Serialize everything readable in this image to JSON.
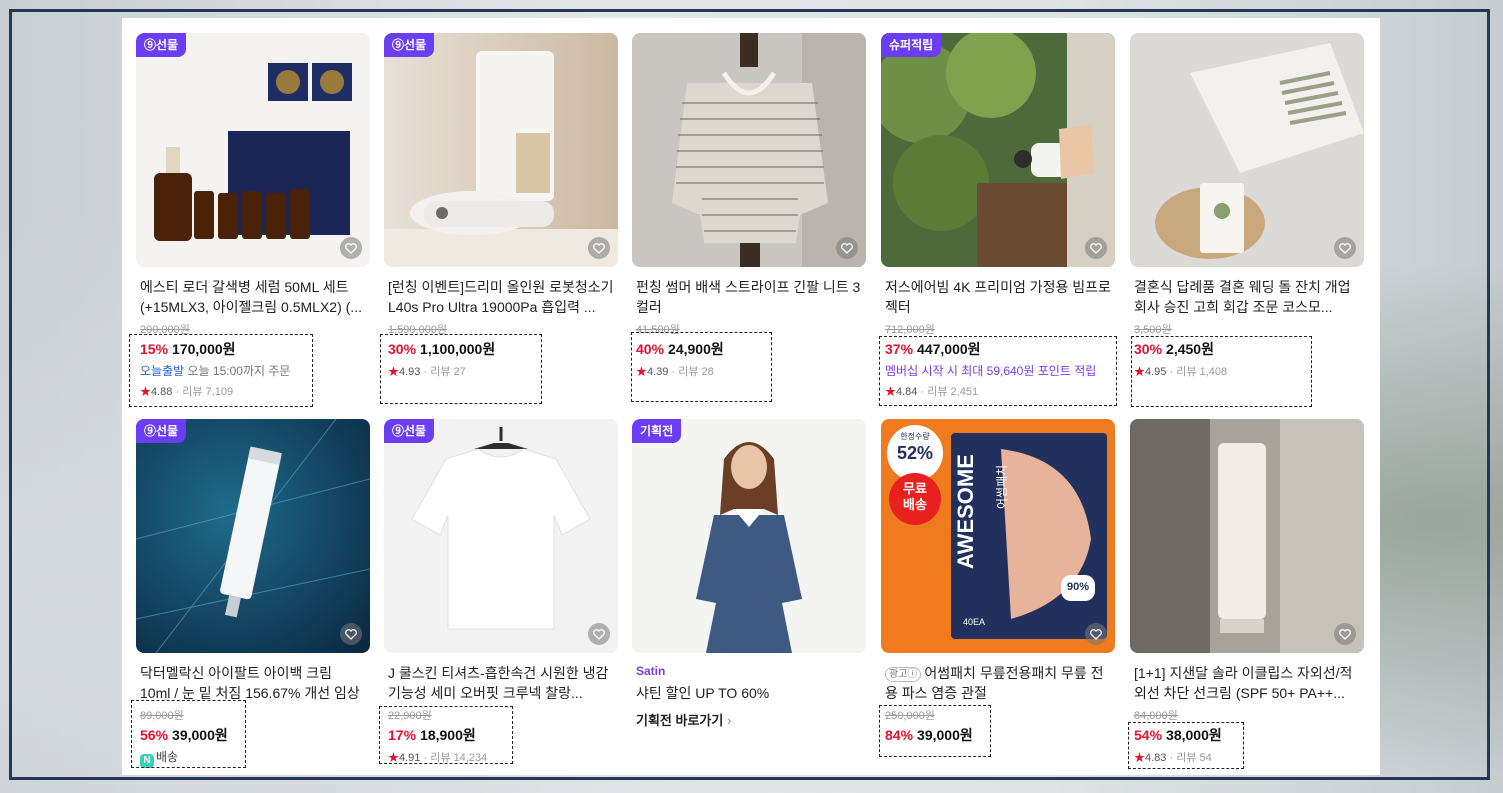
{
  "colors": {
    "discount": "#e4112e",
    "badge_purple": "#6b3df5",
    "frame": "#253a52"
  },
  "products": [
    {
      "badge": "⑨선물",
      "title": "에스티 로더 갈색병 세럼 50ML 세트 (+15MLX3, 아이젤크림 0.5MLX2) (...",
      "original_price": "200,000원",
      "discount": "15%",
      "price": "170,000원",
      "promo_a": "오늘출발",
      "promo_b": "오늘 15:00까지 주문",
      "rating": "4.88",
      "review_label": "리뷰",
      "reviews": "7,109"
    },
    {
      "badge": "⑨선물",
      "title": "[런칭 이벤트]드리미 올인원 로봇청소기 L40s Pro Ultra 19000Pa 흡입력 ...",
      "original_price": "1,590,000원",
      "discount": "30%",
      "price": "1,100,000원",
      "rating": "4.93",
      "review_label": "리뷰",
      "reviews": "27"
    },
    {
      "title": "펀칭 썸머 배색 스트라이프 긴팔 니트 3컬러",
      "original_price": "41,500원",
      "discount": "40%",
      "price": "24,900원",
      "rating": "4.39",
      "review_label": "리뷰",
      "reviews": "28"
    },
    {
      "badge": "슈퍼적립",
      "title": "저스에어빔 4K 프리미엄 가정용 빔프로젝터",
      "original_price": "712,000원",
      "discount": "37%",
      "price": "447,000원",
      "promo": "멤버십 시작 시 최대 59,640원 포인트 적립",
      "rating": "4.84",
      "review_label": "리뷰",
      "reviews": "2,451"
    },
    {
      "title": "결혼식 답례품 결혼 웨딩 돌 잔치 개업 회사 승진 고희 회갑 조문 코스모...",
      "original_price": "3,500원",
      "discount": "30%",
      "price": "2,450원",
      "rating": "4.95",
      "review_label": "리뷰",
      "reviews": "1,408"
    },
    {
      "badge": "⑨선물",
      "title": "닥터멜락신 아이팔트 아이백 크림 10ml / 눈 밑 처짐 156.67% 개선 임상",
      "original_price": "89,000원",
      "discount": "56%",
      "price": "39,000원",
      "delivery_icon": "N",
      "delivery": "배송"
    },
    {
      "badge": "⑨선물",
      "title": "J 쿨스킨 티셔츠-흡한속건 시원한 냉감 기능성 세미 오버핏 크루넥 찰랑...",
      "original_price": "22,900원",
      "discount": "17%",
      "price": "18,900원",
      "rating": "4.91",
      "review_label": "리뷰",
      "reviews": "14,234"
    },
    {
      "badge": "기획전",
      "brand": "Satin",
      "title": "샤틴 할인 UP TO 60%",
      "link": "기획전 바로가기"
    },
    {
      "ad_label": "광고ⓘ",
      "title": "어썸패치 무릎전용패치 무릎 전용 파스 염증 관절",
      "original_price": "250,000원",
      "discount": "84%",
      "price": "39,000원",
      "image_text": {
        "top": "한정수량",
        "pct": "52%",
        "free1": "무료",
        "free2": "배송",
        "brand": "AWESOME",
        "sub": "어썸패치",
        "count": "90%",
        "ea": "40EA"
      }
    },
    {
      "title": "[1+1] 지샌달 솔라 이클립스 자외선/적외선 차단 선크림 (SPF 50+ PA++...",
      "original_price": "84,000원",
      "discount": "54%",
      "price": "38,000원",
      "rating": "4.83",
      "review_label": "리뷰",
      "reviews": "54"
    }
  ]
}
